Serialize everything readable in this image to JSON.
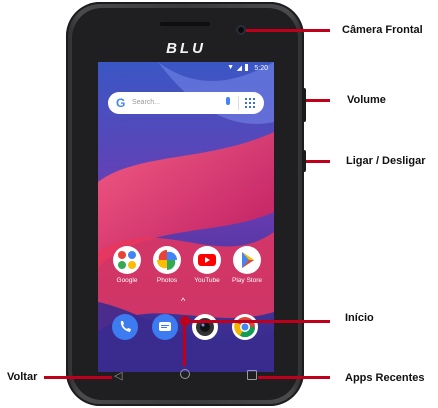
{
  "phone": {
    "brand": "BLU",
    "status_time": "5:20",
    "search_placeholder": "Search...",
    "search_g": "G",
    "apps": [
      {
        "label": "Google"
      },
      {
        "label": "Photos"
      },
      {
        "label": "YouTube"
      },
      {
        "label": "Play Store"
      }
    ],
    "caret": "^"
  },
  "callouts": {
    "camera_frontal": "Câmera Frontal",
    "volume": "Volume",
    "ligar_desligar": "Ligar / Desligar",
    "inicio": "Início",
    "voltar": "Voltar",
    "apps_recentes": "Apps Recentes"
  },
  "colors": {
    "callout_line": "#c0001a",
    "phone_body": "#3a3a3c",
    "wallpaper_primary": "#5b3fa8",
    "wallpaper_accent": "#e8365d"
  }
}
